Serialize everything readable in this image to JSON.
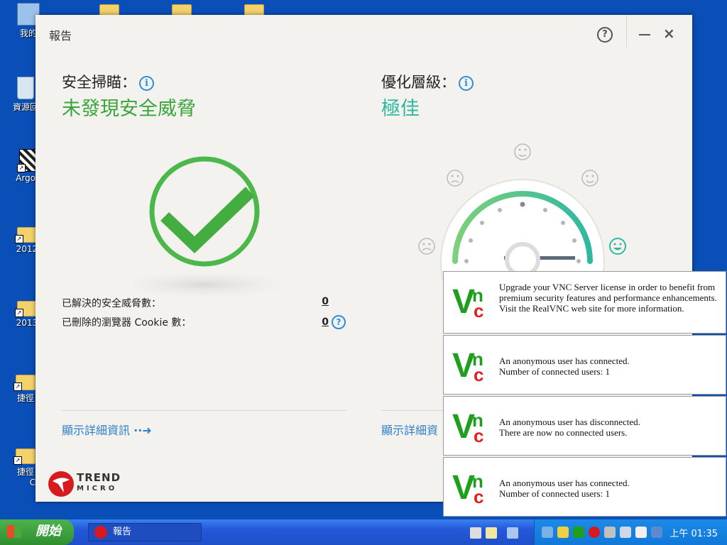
{
  "desktop": {
    "icons": [
      {
        "label": "我的"
      },
      {
        "label": "資源回"
      },
      {
        "label": "Argob"
      },
      {
        "label": "2012"
      },
      {
        "label": "2013"
      },
      {
        "label": "捷徑"
      },
      {
        "label": "捷徑"
      }
    ],
    "partial_char": "C"
  },
  "window": {
    "title": "報告",
    "help_label": "?",
    "close_label": "×",
    "scan_label": "安全掃瞄：",
    "scan_status": "未發現安全威脅",
    "opt_label": "優化層級：",
    "opt_status": "極佳",
    "info_icon": "i",
    "stats": [
      {
        "label": "已解決的安全威脅數：",
        "value": "0"
      },
      {
        "label": "已刪除的瀏覽器 Cookie 數：",
        "value": "0"
      }
    ],
    "details_link": "顯示詳細資訊",
    "details_link_partial": "顯示詳細資",
    "brand_name": "TREND",
    "brand_sub": "MICRO"
  },
  "toasts": [
    {
      "text": "Upgrade your VNC Server license in order to benefit from premium security features and performance enhancements. Visit the RealVNC web site for more information."
    },
    {
      "text": "An anonymous user has connected.\nNumber of connected users: 1"
    },
    {
      "text": "An anonymous user has disconnected.\nThere are now no connected users."
    },
    {
      "text": "An anonymous user has connected.\nNumber of connected users: 1"
    }
  ],
  "taskbar": {
    "start_label": "開始",
    "task_title": "報告",
    "clock": "上午 01:35"
  },
  "colors": {
    "accent_green": "#3aa63a",
    "accent_teal": "#2fb8a0",
    "link_blue": "#2d7fc8",
    "trend_red": "#d71920",
    "vnc_green": "#1ea01e",
    "vnc_red": "#e02020"
  }
}
